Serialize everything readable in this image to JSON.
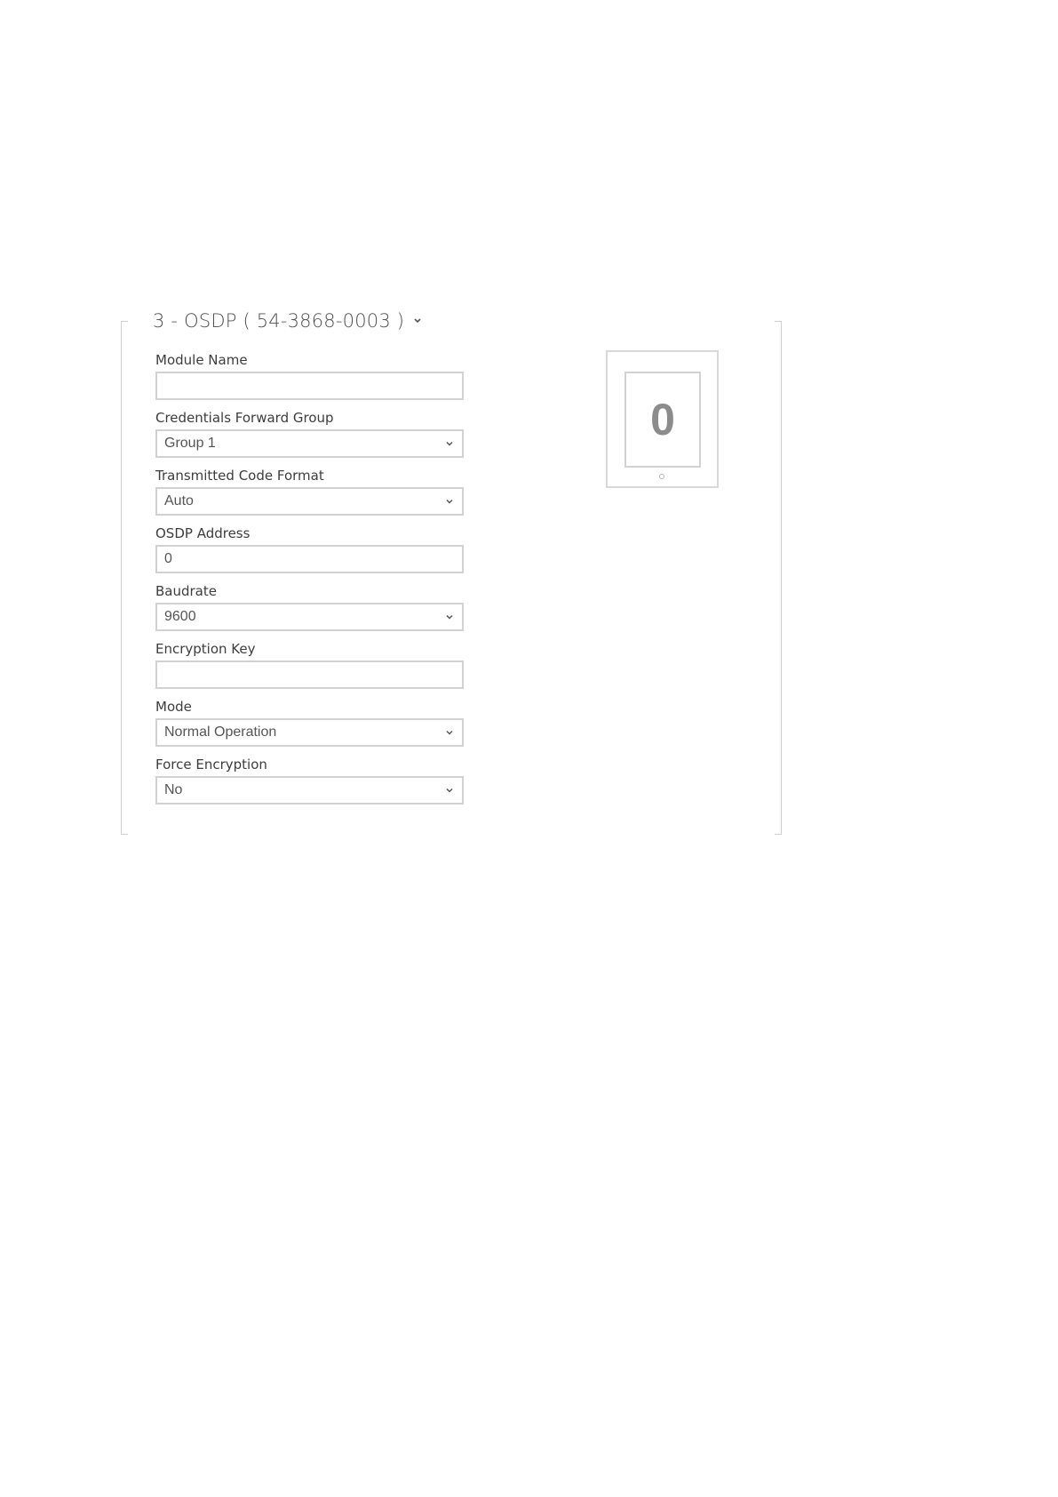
{
  "module": {
    "title": "3 - OSDP ( 54-3868-0003 )",
    "expand_icon": "chevron-down-icon"
  },
  "fields": {
    "module_name": {
      "label": "Module Name",
      "value": ""
    },
    "credentials_forward_group": {
      "label": "Credentials Forward Group",
      "value": "Group 1"
    },
    "transmitted_code_format": {
      "label": "Transmitted Code Format",
      "value": "Auto"
    },
    "osdp_address": {
      "label": "OSDP Address",
      "value": "0"
    },
    "baudrate": {
      "label": "Baudrate",
      "value": "9600"
    },
    "encryption_key": {
      "label": "Encryption Key",
      "value": ""
    },
    "mode": {
      "label": "Mode",
      "value": "Normal Operation"
    },
    "force_encryption": {
      "label": "Force Encryption",
      "value": "No"
    }
  },
  "preview": {
    "digit": "0",
    "icon": "keypad-module-icon"
  },
  "colors": {
    "border": "#d2d2d2",
    "label_text": "#3d3d3d",
    "value_text": "#555555",
    "digit": "#8c8c8c"
  }
}
